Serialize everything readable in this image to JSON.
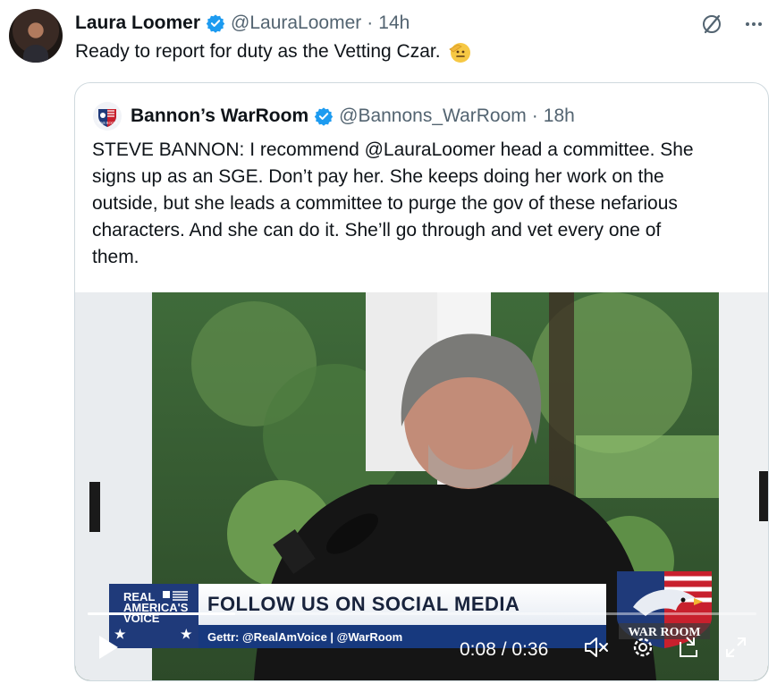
{
  "post": {
    "display_name": "Laura Loomer",
    "handle": "@LauraLoomer",
    "separator": "·",
    "time": "14h",
    "text": "Ready to report for duty as the Vetting Czar."
  },
  "quoted": {
    "display_name": "Bannon’s WarRoom",
    "handle": "@Bannons_WarRoom",
    "separator": "·",
    "time": "18h",
    "text": "STEVE BANNON: I recommend @LauraLoomer head a committee. She\nsigns up as an SGE. Don’t pay her. She keeps doing her work on the\noutside, but she leads a committee to purge the gov of these nefarious\ncharacters. And she can do it. She’ll go through and vet every one of\nthem.",
    "logo_text": "WAR ROOM"
  },
  "video": {
    "lower_third": {
      "brand_line1": "REAL",
      "brand_line2": "AMERICA'S",
      "brand_line3": "VOICE",
      "headline": "FOLLOW US ON SOCIAL MEDIA",
      "subline": "Gettr: @RealAmVoice | @WarRoom",
      "logo_text": "WAR ROOM"
    },
    "current_time": "0:08",
    "duration": "0:36",
    "time_display": "0:08 / 0:36",
    "progress_fraction": 0.22
  },
  "colors": {
    "verified": "#1d9bf0",
    "muted": "#536471",
    "border": "#cfd9de",
    "banner_blue": "#17397e"
  },
  "icons": [
    "verified-badge-icon",
    "grok-icon",
    "more-icon",
    "play-icon",
    "mute-icon",
    "settings-icon",
    "pip-icon",
    "fullscreen-icon"
  ]
}
